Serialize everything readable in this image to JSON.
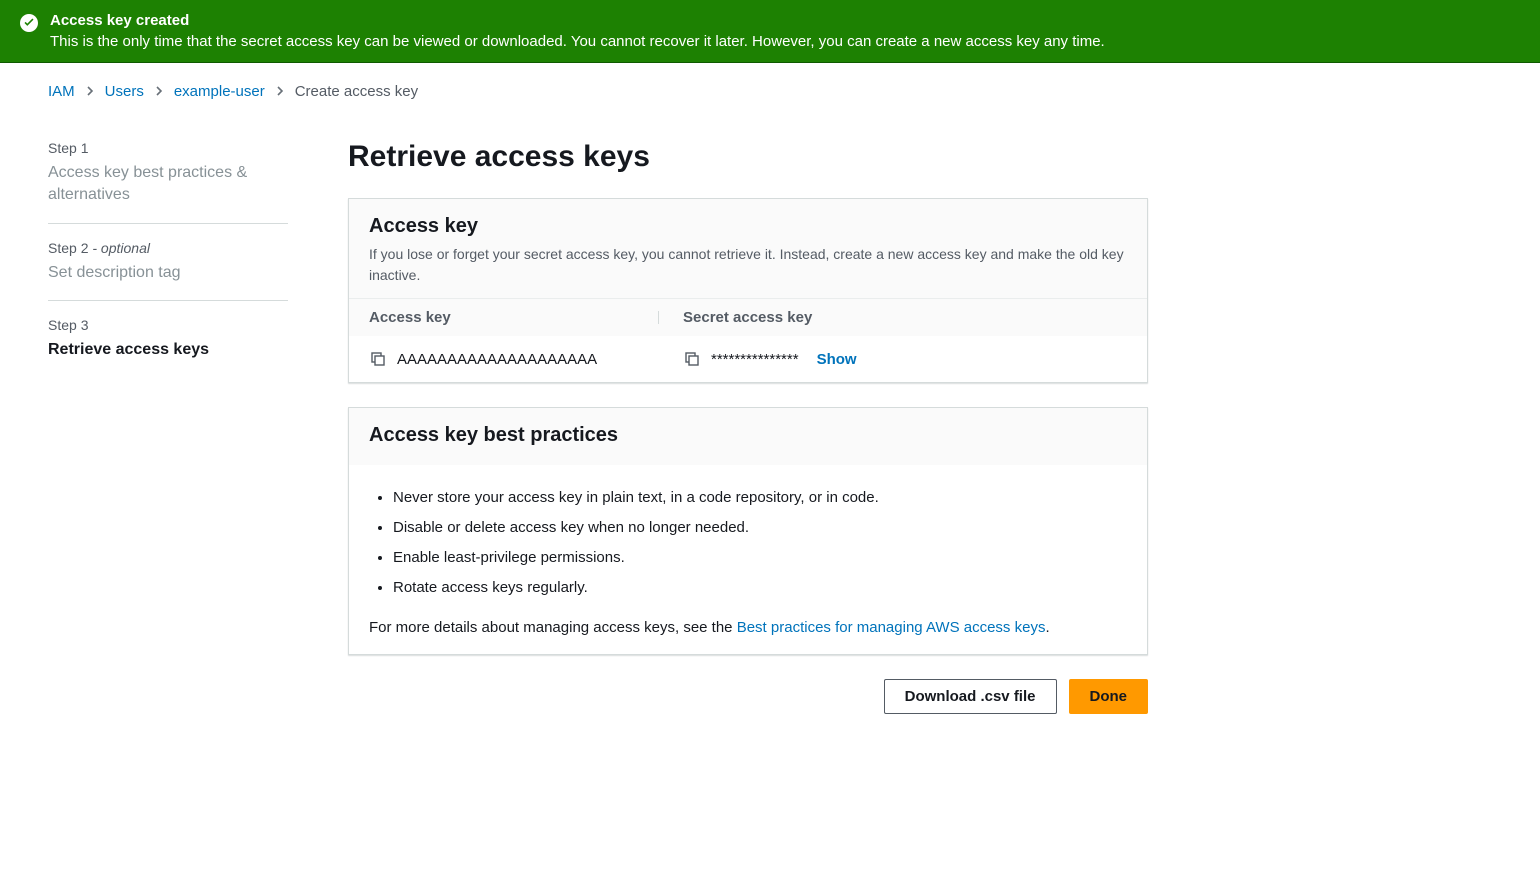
{
  "flash": {
    "title": "Access key created",
    "message": "This is the only time that the secret access key can be viewed or downloaded. You cannot recover it later. However, you can create a new access key any time."
  },
  "breadcrumb": {
    "items": [
      "IAM",
      "Users",
      "example-user"
    ],
    "current": "Create access key"
  },
  "wizard": {
    "steps": [
      {
        "label": "Step 1",
        "title": "Access key best practices & alternatives",
        "optional": ""
      },
      {
        "label": "Step 2",
        "title": "Set description tag",
        "optional": " - optional"
      },
      {
        "label": "Step 3",
        "title": "Retrieve access keys",
        "optional": ""
      }
    ]
  },
  "content": {
    "page_title": "Retrieve access keys",
    "access_key_panel": {
      "title": "Access key",
      "description": "If you lose or forget your secret access key, you cannot retrieve it. Instead, create a new access key and make the old key inactive.",
      "col1_label": "Access key",
      "col2_label": "Secret access key",
      "access_key_value": "AAAAAAAAAAAAAAAAAAAA",
      "secret_key_masked": "***************",
      "show_label": "Show"
    },
    "best_practices_panel": {
      "title": "Access key best practices",
      "bullets": [
        "Never store your access key in plain text, in a code repository, or in code.",
        "Disable or delete access key when no longer needed.",
        "Enable least-privilege permissions.",
        "Rotate access keys regularly."
      ],
      "more_prefix": "For more details about managing access keys, see the ",
      "more_link": "Best practices for managing AWS access keys",
      "more_suffix": "."
    }
  },
  "actions": {
    "download": "Download .csv file",
    "done": "Done"
  }
}
